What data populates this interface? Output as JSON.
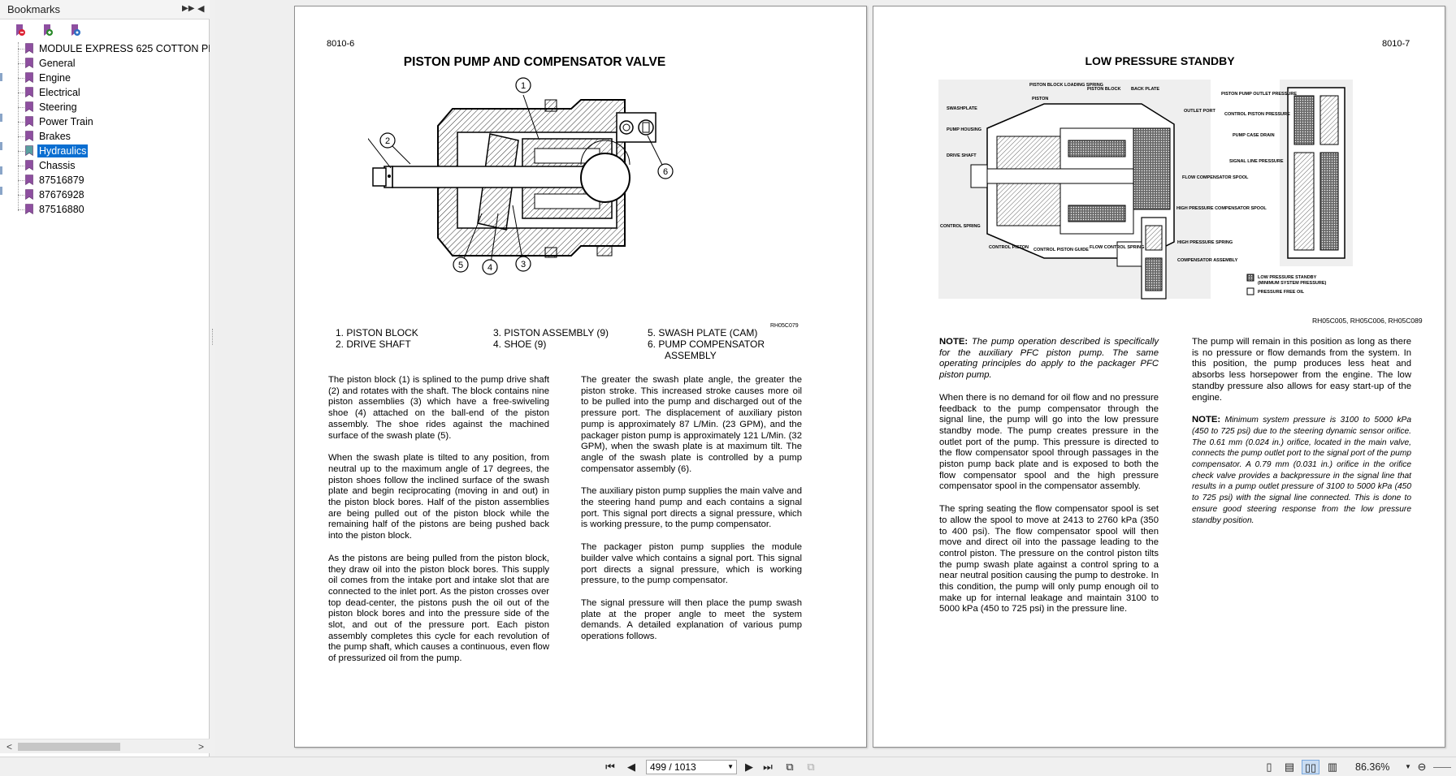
{
  "bookmarks": {
    "title": "Bookmarks",
    "expand_icon": "double-chevron-right",
    "collapse_icon": "triangle-left",
    "toolbar_icons": [
      "bookmark-delete-icon",
      "bookmark-add-icon",
      "bookmark-properties-icon"
    ],
    "items": [
      {
        "label": "MODULE EXPRESS 625 COTTON PICKER"
      },
      {
        "label": "General"
      },
      {
        "label": "Engine"
      },
      {
        "label": "Electrical"
      },
      {
        "label": "Steering"
      },
      {
        "label": "Power Train"
      },
      {
        "label": "Brakes"
      },
      {
        "label": "Hydraulics",
        "selected": true
      },
      {
        "label": "Chassis"
      },
      {
        "label": "87516879"
      },
      {
        "label": "87676928"
      },
      {
        "label": "87516880"
      }
    ]
  },
  "left_page": {
    "page_number": "8010-6",
    "title": "PISTON PUMP AND COMPENSATOR VALVE",
    "figure_code": "RH05C079",
    "callouts": [
      "1",
      "2",
      "3",
      "4",
      "5",
      "6"
    ],
    "legend": [
      "1.  PISTON BLOCK",
      "2.  DRIVE SHAFT",
      "3.  PISTON ASSEMBLY (9)",
      "4.  SHOE (9)",
      "5.  SWASH PLATE (CAM)",
      "6.  PUMP COMPENSATOR",
      "ASSEMBLY"
    ],
    "col1": [
      "The piston block (1) is splined to the pump drive shaft (2) and rotates with the shaft. The block contains nine piston assemblies (3) which have a free-swiveling shoe (4) attached on the ball-end of the piston assembly. The shoe rides against the machined surface of the swash plate (5).",
      "When the swash plate is tilted to any position, from neutral up to the maximum angle of 17 degrees, the piston shoes follow the inclined surface of the swash plate and begin reciprocating (moving in and out) in the piston block bores. Half of the piston assemblies are being pulled out of the piston block while the remaining half of the pistons are being pushed back into the piston block.",
      "As the pistons are being pulled from the piston block, they draw oil into the piston block bores. This supply oil comes from the intake port and intake slot that are connected to the inlet port. As the piston crosses over top dead-center, the pistons push the oil out of the piston block bores and into the pressure side of the slot, and out of the pressure port. Each piston assembly completes this cycle for each revolution of the pump shaft, which causes a continuous, even flow of pressurized oil from the pump."
    ],
    "col2": [
      "The greater the swash plate angle, the greater the piston stroke. This increased stroke causes more oil to be pulled into the pump and discharged out of the pressure port. The displacement of auxiliary piston pump is approximately 87 L/Min. (23 GPM), and the packager piston pump is approximately 121 L/Min. (32 GPM), when the swash plate is at maximum tilt. The angle of the swash plate is controlled by a pump compensator assembly (6).",
      "The auxiliary piston pump supplies the main valve and the steering hand pump and each contains a signal port. This signal port directs a signal pressure, which is working pressure, to the pump compensator.",
      "The packager piston pump supplies the module builder valve which contains a signal port. This signal port directs a signal pressure, which is working pressure, to the pump compensator.",
      "The signal pressure will then place the pump swash plate at the proper angle to meet the system demands. A detailed explanation of various pump operations follows."
    ]
  },
  "right_page": {
    "page_number": "8010-7",
    "title": "LOW PRESSURE STANDBY",
    "figure_code": "RH05C005, RH05C006, RH05C089",
    "figure_labels": {
      "piston_block_loading_spring": "PISTON BLOCK LOADING SPRING",
      "piston": "PISTON",
      "piston_block": "PISTON BLOCK",
      "back_plate": "BACK PLATE",
      "swashplate": "SWASHPLATE",
      "outlet_port": "OUTLET PORT",
      "pump_housing": "PUMP HOUSING",
      "drive_shaft": "DRIVE SHAFT",
      "flow_compensator_spool": "FLOW COMPENSATOR SPOOL",
      "high_pressure_compensator_spool": "HIGH PRESSURE COMPENSATOR SPOOL",
      "control_spring": "CONTROL SPRING",
      "high_pressure_spring": "HIGH PRESSURE SPRING",
      "control_piston": "CONTROL PISTON",
      "control_piston_guide": "CONTROL PISTON GUIDE",
      "flow_control_spring": "FLOW CONTROL SPRING",
      "compensator_assembly": "COMPENSATOR ASSEMBLY",
      "piston_pump_outlet_pressure": "PISTON PUMP OUTLET PRESSURE",
      "control_piston_pressure": "CONTROL PISTON PRESSURE",
      "pump_case_drain": "PUMP CASE DRAIN",
      "signal_line_pressure": "SIGNAL LINE PRESSURE",
      "legend_low_pressure": "LOW PRESSURE STANDBY",
      "legend_low_pressure_sub": "(MINIMUM SYSTEM PRESSURE)",
      "legend_free_oil": "PRESSURE FREE OIL"
    },
    "note1_label": "NOTE:",
    "note1_text": "The pump operation described is specifically for the auxiliary PFC piston pump. The same operating principles do apply to the packager PFC piston pump.",
    "col1": [
      "When there is no demand for oil flow and no pressure feedback to the pump compensator through the signal line, the pump will go into the low pressure standby mode. The pump creates pressure in the outlet port of the pump. This pressure is directed to the flow compensator spool through passages in the piston pump back plate and is exposed to both the flow compensator spool and the high pressure compensator spool in the compensator assembly.",
      "The spring seating the flow compensator spool is set to allow the spool to move at 2413 to 2760 kPa (350 to 400 psi). The flow compensator spool will then move and direct oil into the passage leading to the control piston. The pressure on the control piston tilts the pump swash plate against a control spring to a near neutral position causing the pump to destroke. In this condition, the pump will only pump enough oil to make up for internal leakage and maintain 3100 to 5000 kPa (450 to 725 psi) in the pressure line."
    ],
    "col2": [
      "The pump will remain in this position as long as there is no pressure or flow demands from the system. In this position, the pump produces less heat and absorbs less horsepower from the engine. The low standby pressure also allows for easy start-up of the engine."
    ],
    "note2_label": "NOTE:",
    "note2_text": "Minimum system pressure is 3100 to 5000 kPa (450 to 725 psi) due to the steering dynamic sensor orifice. The 0.61 mm (0.024 in.) orifice, located in the main valve, connects the pump outlet port to the signal port of the pump compensator. A 0.79 mm (0.031 in.) orifice in the orifice check valve provides a backpressure in the signal line that results in a pump outlet pressure of 3100 to 5000 kPa (450 to 725 psi) with the signal line connected. This is done to ensure good steering response from the low pressure standby position."
  },
  "statusbar": {
    "first_icon": "first-page-icon",
    "prev_icon": "prev-page-icon",
    "page_display": "499 / 1013",
    "next_icon": "next-page-icon",
    "last_icon": "last-page-icon",
    "zoom": "86.36%"
  },
  "colors": {
    "selection": "#0a6ed1",
    "bookmark_flag": "#8e4fa0",
    "panel_bg": "#f0f0f0"
  }
}
